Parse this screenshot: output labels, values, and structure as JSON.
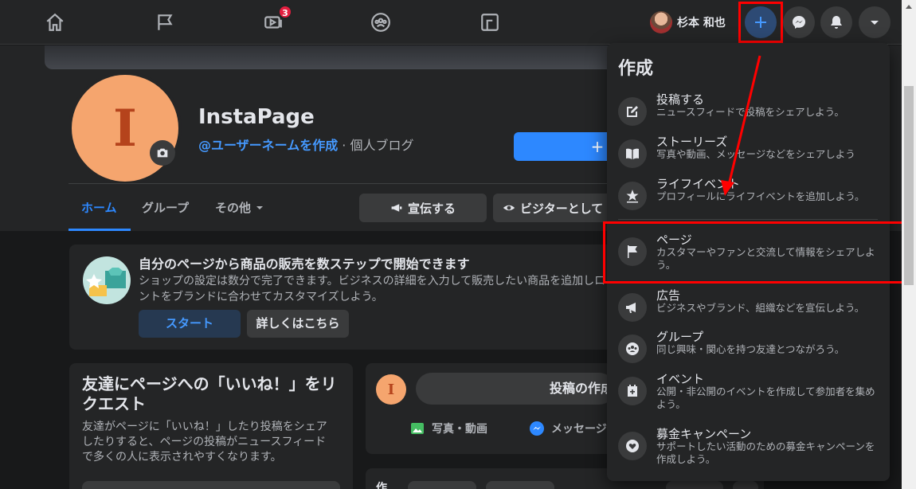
{
  "nav": {
    "watch_badge": "3",
    "profile_name": "杉本 和也"
  },
  "page": {
    "name": "InstaPage",
    "avatar_letter": "I",
    "username_link": "@ユーザーネームを作成",
    "category": " · 個人ブログ",
    "blue_button_label": "+"
  },
  "tabs": {
    "home": "ホーム",
    "groups": "グループ",
    "more": "その他"
  },
  "actions": {
    "promote": "宣伝する",
    "view_as_visitor": "ビジターとして"
  },
  "shop_card": {
    "title": "自分のページから商品の販売を数ステップで開始できます",
    "description": "ショップの設定は数分で完了できます。ビジネスの詳細を入力して販売したい商品を追加しロントをブランドに合わせてカスタマイズしよう。",
    "start_button": "スタート",
    "details_button": "詳しくはこちら"
  },
  "invite_card": {
    "title": "友達にページへの「いいね！」をリクエスト",
    "description": "友達がページに「いいね！」したり投稿をシェアしたりすると、ページの投稿がニュースフィードで多くの人に表示されやすくなります。"
  },
  "composer": {
    "avatar_letter": "I",
    "placeholder": "投稿の作成",
    "photo_video": "写真・動画",
    "message": "メッセージ",
    "bottom_label": "作"
  },
  "create_menu": {
    "title": "作成",
    "items": [
      {
        "icon": "edit-icon",
        "label": "投稿する",
        "description": "ニュースフィードで投稿をシェアしよう。"
      },
      {
        "icon": "book-icon",
        "label": "ストーリーズ",
        "description": "写真や動画、メッセージなどをシェアしよう"
      },
      {
        "icon": "star-icon",
        "label": "ライフイベント",
        "description": "プロフィールにライフイベントを追加しよう。"
      },
      {
        "icon": "flag-icon",
        "label": "ページ",
        "description": "カスタマーやファンと交流して情報をシェアしよう。"
      },
      {
        "icon": "megaphone-icon",
        "label": "広告",
        "description": "ビジネスやブランド、組織などを宣伝しよう。"
      },
      {
        "icon": "group-icon",
        "label": "グループ",
        "description": "同じ興味・関心を持つ友達とつながろう。"
      },
      {
        "icon": "calendar-plus-icon",
        "label": "イベント",
        "description": "公開・非公開のイベントを作成して参加者を集めよう。"
      },
      {
        "icon": "heart-coin-icon",
        "label": "募金キャンペーン",
        "description": "サポートしたい活動のための募金キャンペーンを作成しよう。"
      }
    ]
  },
  "colors": {
    "accent": "#2d88ff",
    "highlight": "#ff0000",
    "background": "#18191a",
    "surface": "#242526"
  }
}
